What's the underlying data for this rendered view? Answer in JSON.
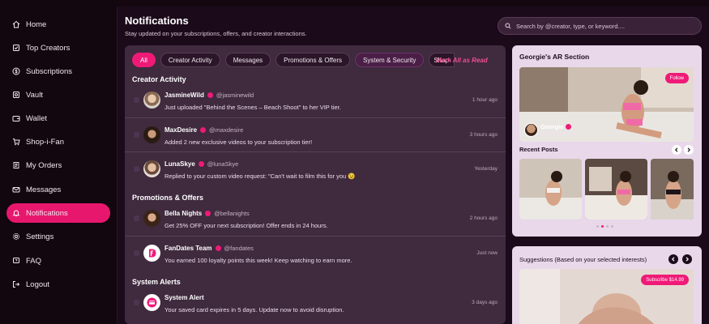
{
  "sidebar": {
    "items": [
      {
        "label": "Home",
        "icon": "home-icon"
      },
      {
        "label": "Top Creators",
        "icon": "star-icon"
      },
      {
        "label": "Subscriptions",
        "icon": "dollar-icon"
      },
      {
        "label": "Vault",
        "icon": "vault-icon"
      },
      {
        "label": "Wallet",
        "icon": "wallet-icon"
      },
      {
        "label": "Shop-i-Fan",
        "icon": "cart-icon"
      },
      {
        "label": "My Orders",
        "icon": "orders-icon"
      },
      {
        "label": "Messages",
        "icon": "mail-icon"
      },
      {
        "label": "Notifications",
        "icon": "bell-icon",
        "active": true
      },
      {
        "label": "Settings",
        "icon": "gear-icon"
      },
      {
        "label": "FAQ",
        "icon": "faq-icon"
      },
      {
        "label": "Logout",
        "icon": "logout-icon"
      }
    ]
  },
  "header": {
    "title": "Notifications",
    "subtitle": "Stay updated on your subscriptions, offers, and creator interactions.",
    "search_placeholder": "Search by @creator, type, or keyword...."
  },
  "filters": {
    "chips": [
      "All",
      "Creator Activity",
      "Messages",
      "Promotions & Offers",
      "System & Security",
      "Shop-"
    ],
    "active": "All",
    "mark_all": "Mark All as Read"
  },
  "sections": {
    "creator_activity": "Creator Activity",
    "promotions": "Promotions & Offers",
    "system": "System Alerts"
  },
  "notifications": [
    {
      "name": "JasmineWild",
      "handle": "@jasminewild",
      "message": "Just uploaded \"Behind the Scenes – Beach Shoot\" to her VIP tier.",
      "time": "1 hour ago"
    },
    {
      "name": "MaxDesire",
      "handle": "@maxdesire",
      "message": "Added 2 new exclusive videos to your subscription tier!",
      "time": "3 hours ago"
    },
    {
      "name": "LunaSkye",
      "handle": "@lunaSkye",
      "message": "Replied to your custom video request: \"Can't wait to film this for you 😉",
      "time": "Yesterday"
    },
    {
      "name": "Bella Nights",
      "handle": "@bellanights",
      "message": "Get 25% OFF your next subscription! Offer ends in 24 hours.",
      "time": "2 hours ago"
    },
    {
      "name": "FanDates Team",
      "handle": "@fandates",
      "message": "You earned 100 loyalty points this week! Keep watching to earn more.",
      "time": "Just now"
    },
    {
      "name": "System Alert",
      "handle": "",
      "message": "Your saved card expires in 5 days. Update now to avoid disruption.",
      "time": "3 days ago"
    }
  ],
  "ar_section": {
    "title": "Georgie's AR Section",
    "follow": "Follow",
    "creator_name": "Georgie",
    "creator_handle": "@georgie.official",
    "recent_posts": "Recent Posts"
  },
  "suggestions": {
    "title": "Suggestions (Based on your selected interests)",
    "subscribe": "Subscribe $14.99"
  },
  "colors": {
    "accent": "#ef1a78",
    "panel": "#3f2a3e",
    "card": "#e8d8ea"
  }
}
